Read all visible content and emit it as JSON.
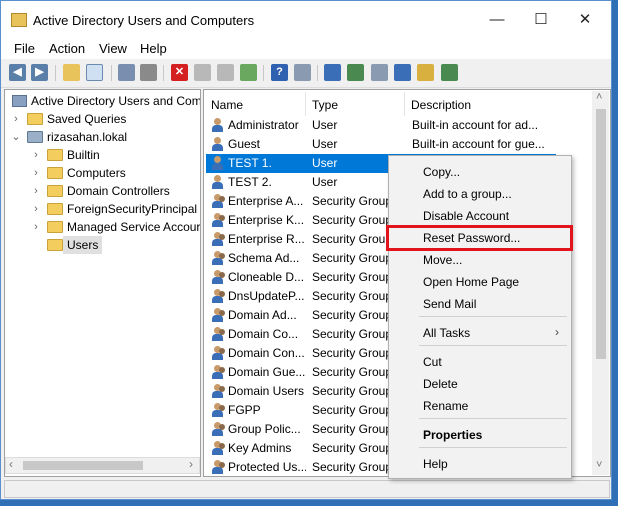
{
  "window": {
    "title": "Active Directory Users and Computers",
    "minimize": "—",
    "maximize": "☐",
    "close": "✕"
  },
  "menu": [
    "File",
    "Action",
    "View",
    "Help"
  ],
  "tree": {
    "root": "Active Directory Users and Com",
    "items": [
      {
        "label": "Saved Queries",
        "indent": 1,
        "expander": "›"
      },
      {
        "label": "rizasahan.lokal",
        "indent": 1,
        "expander": "⌄"
      },
      {
        "label": "Builtin",
        "indent": 2,
        "expander": "›"
      },
      {
        "label": "Computers",
        "indent": 2,
        "expander": "›"
      },
      {
        "label": "Domain Controllers",
        "indent": 2,
        "expander": "›"
      },
      {
        "label": "ForeignSecurityPrincipal",
        "indent": 2,
        "expander": "›"
      },
      {
        "label": "Managed Service Accour",
        "indent": 2,
        "expander": "›"
      },
      {
        "label": "Users",
        "indent": 2,
        "expander": ""
      }
    ]
  },
  "list": {
    "columns": {
      "name": "Name",
      "type": "Type",
      "description": "Description"
    },
    "rows": [
      {
        "name": "Administrator",
        "type": "User",
        "description": "Built-in account for ad...",
        "icon": "user"
      },
      {
        "name": "Guest",
        "type": "User",
        "description": "Built-in account for gue...",
        "icon": "user"
      },
      {
        "name": "TEST 1.",
        "type": "User",
        "description": "",
        "icon": "user"
      },
      {
        "name": "TEST 2.",
        "type": "User",
        "description": "",
        "icon": "user"
      },
      {
        "name": "Enterprise A...",
        "type": "Security Group",
        "description": "",
        "icon": "group"
      },
      {
        "name": "Enterprise K...",
        "type": "Security Group",
        "description": "",
        "icon": "group"
      },
      {
        "name": "Enterprise R...",
        "type": "Security Group",
        "description": "",
        "icon": "group"
      },
      {
        "name": "Schema Ad...",
        "type": "Security Group",
        "description": "",
        "icon": "group"
      },
      {
        "name": "Cloneable D...",
        "type": "Security Group",
        "description": "",
        "icon": "group"
      },
      {
        "name": "DnsUpdateP...",
        "type": "Security Group",
        "description": "",
        "icon": "group"
      },
      {
        "name": "Domain Ad...",
        "type": "Security Group",
        "description": "",
        "icon": "group"
      },
      {
        "name": "Domain Co...",
        "type": "Security Group",
        "description": "",
        "icon": "group"
      },
      {
        "name": "Domain Con...",
        "type": "Security Group",
        "description": "",
        "icon": "group"
      },
      {
        "name": "Domain Gue...",
        "type": "Security Group",
        "description": "",
        "icon": "group"
      },
      {
        "name": "Domain Users",
        "type": "Security Group",
        "description": "",
        "icon": "group"
      },
      {
        "name": "FGPP",
        "type": "Security Group",
        "description": "",
        "icon": "group"
      },
      {
        "name": "Group Polic...",
        "type": "Security Group",
        "description": "",
        "icon": "group"
      },
      {
        "name": "Key Admins",
        "type": "Security Group",
        "description": "",
        "icon": "group"
      },
      {
        "name": "Protected Us...",
        "type": "Security Group",
        "description": "",
        "icon": "group"
      }
    ]
  },
  "context_menu": {
    "items": [
      {
        "label": "Copy...",
        "bold": false,
        "sep_after": false
      },
      {
        "label": "Add to a group...",
        "bold": false,
        "sep_after": false
      },
      {
        "label": "Disable Account",
        "bold": false,
        "sep_after": false
      },
      {
        "label": "Reset Password...",
        "bold": false,
        "sep_after": false
      },
      {
        "label": "Move...",
        "bold": false,
        "sep_after": false
      },
      {
        "label": "Open Home Page",
        "bold": false,
        "sep_after": false
      },
      {
        "label": "Send Mail",
        "bold": false,
        "sep_after": true
      },
      {
        "label": "All Tasks",
        "bold": false,
        "sep_after": true,
        "submenu": "›"
      },
      {
        "label": "Cut",
        "bold": false,
        "sep_after": false
      },
      {
        "label": "Delete",
        "bold": false,
        "sep_after": false
      },
      {
        "label": "Rename",
        "bold": false,
        "sep_after": true
      },
      {
        "label": "Properties",
        "bold": true,
        "sep_after": true
      },
      {
        "label": "Help",
        "bold": false,
        "sep_after": false
      }
    ]
  },
  "colors": {
    "selection": "#0078d7",
    "highlight_box": "#e0141a"
  },
  "scroll": {
    "left_arrow": "‹",
    "right_arrow": "›",
    "up_arrow": "˄",
    "down_arrow": "˅"
  }
}
